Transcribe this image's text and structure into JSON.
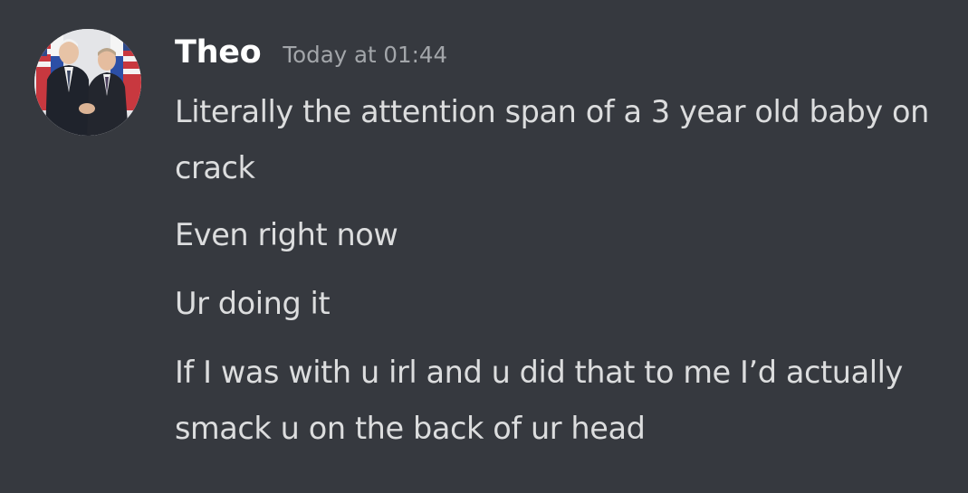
{
  "author": {
    "name": "Theo",
    "timestamp": "Today at 01:44",
    "avatar_icon": "user-avatar-photo"
  },
  "messages": [
    "Literally the attention span of a 3 year old baby on crack",
    "Even right now",
    "Ur doing it",
    "If I was with u irl and u did that to me I’d actually smack u on the back of ur head"
  ],
  "colors": {
    "background": "#36393f",
    "username": "#ffffff",
    "timestamp": "#a3a6aa",
    "message_text": "#dcddde"
  }
}
